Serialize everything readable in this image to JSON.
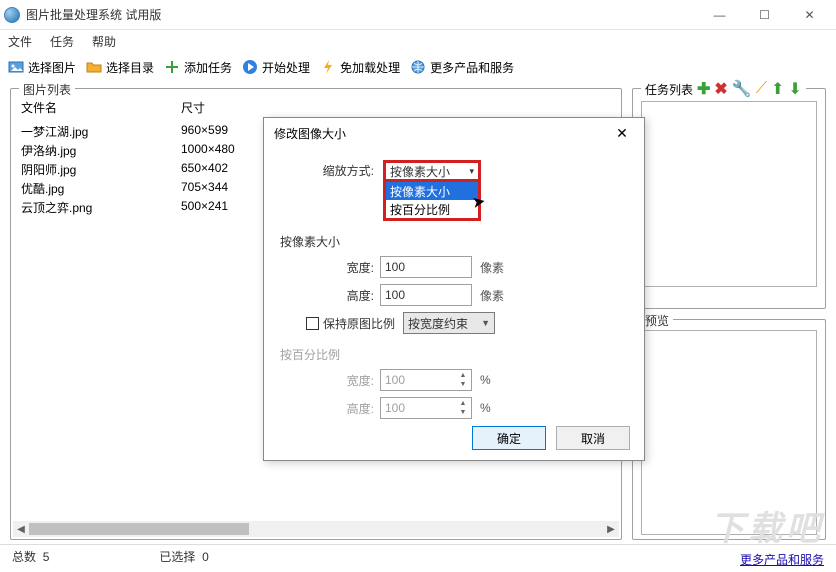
{
  "window": {
    "title": "图片批量处理系统 试用版",
    "min": "—",
    "max": "☐",
    "close": "✕"
  },
  "menu": {
    "file": "文件",
    "task": "任务",
    "help": "帮助"
  },
  "toolbar": {
    "select_image": "选择图片",
    "select_dir": "选择目录",
    "add_task": "添加任务",
    "start": "开始处理",
    "free_plugin": "免加载处理",
    "more": "更多产品和服务"
  },
  "panels": {
    "file_list_title": "图片列表",
    "task_list_title": "任务列表",
    "preview_title": "预览"
  },
  "file_list": {
    "col_name": "文件名",
    "col_size": "尺寸",
    "rows": [
      {
        "name": "一梦江湖.jpg",
        "size": "960×599"
      },
      {
        "name": "伊洛纳.jpg",
        "size": "1000×480"
      },
      {
        "name": "阴阳师.jpg",
        "size": "650×402"
      },
      {
        "name": "优酷.jpg",
        "size": "705×344"
      },
      {
        "name": "云顶之弈.png",
        "size": "500×241"
      }
    ]
  },
  "task_tools": {
    "add": "✚",
    "delete": "✖",
    "config": "🔧",
    "wand": "⟋",
    "up": "⬆",
    "down": "⬇"
  },
  "status": {
    "total_label": "总数",
    "total_value": "5",
    "selected_label": "已选择",
    "selected_value": "0"
  },
  "footer": {
    "link": "更多产品和服务",
    "watermark": "下载吧"
  },
  "dialog": {
    "title": "修改图像大小",
    "close": "✕",
    "scale_method_label": "缩放方式:",
    "scale_method_value": "按像素大小",
    "scale_options": [
      "按像素大小",
      "按百分比例"
    ],
    "pixel_section": "按像素大小",
    "width_label": "宽度:",
    "width_value": "100",
    "height_label": "高度:",
    "height_value": "100",
    "unit_px": "像素",
    "keep_ratio_label": "保持原图比例",
    "ratio_mode": "按宽度约束",
    "percent_section": "按百分比例",
    "pct_width_label": "宽度:",
    "pct_width_value": "100",
    "pct_height_label": "高度:",
    "pct_height_value": "100",
    "unit_pct": "%",
    "ok": "确定",
    "cancel": "取消"
  }
}
